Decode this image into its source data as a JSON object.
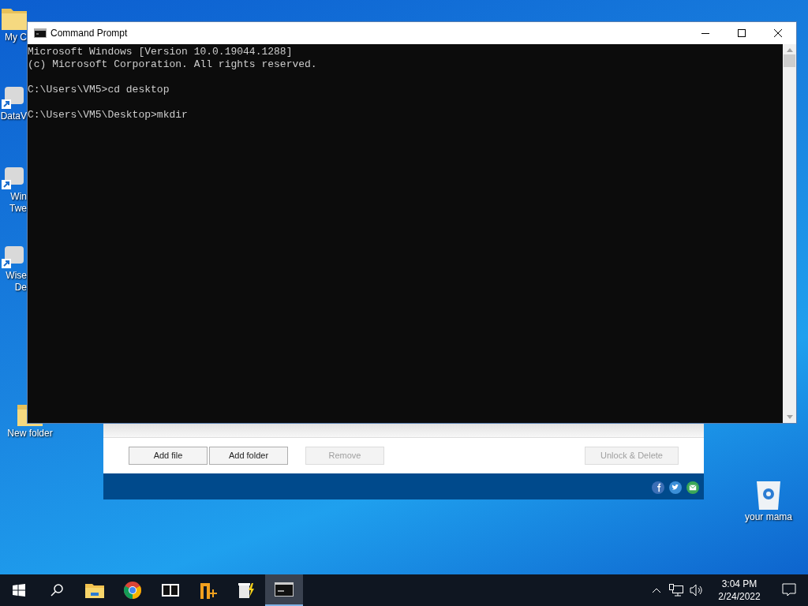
{
  "desktop_icons_cut": [
    {
      "kind": "folder",
      "label_lines": [
        "My C"
      ]
    },
    {
      "kind": "shortcut",
      "label_lines": [
        "DataV"
      ]
    },
    {
      "kind": "shortcut",
      "label_lines": [
        "Win",
        "Twe"
      ]
    },
    {
      "kind": "shortcut",
      "label_lines": [
        "Wise",
        "De"
      ]
    }
  ],
  "desktop_icons": [
    {
      "kind": "folder",
      "label_lines": [
        "New folder"
      ]
    },
    {
      "kind": "recycle",
      "label_lines": [
        "your mama"
      ]
    }
  ],
  "background_window": {
    "buttons": [
      {
        "label": "Add file",
        "disabled": false
      },
      {
        "label": "Add folder",
        "disabled": false
      },
      {
        "label": "Remove",
        "disabled": true
      },
      {
        "label": "Unlock & Delete",
        "disabled": true
      }
    ],
    "social": [
      {
        "kind": "facebook",
        "color": "#3b6fb6"
      },
      {
        "kind": "twitter",
        "color": "#3b8fd8"
      },
      {
        "kind": "mail",
        "color": "#3aa757"
      }
    ]
  },
  "window": {
    "title": "Command Prompt"
  },
  "console": {
    "blocks": [
      [
        "Microsoft Windows [Version 10.0.19044.1288]",
        "(c) Microsoft Corporation. All rights reserved."
      ],
      [
        "C:\\Users\\VM5>cd desktop"
      ],
      [
        "C:\\Users\\VM5\\Desktop>mkdir"
      ]
    ]
  },
  "taskbar": {
    "items": [
      {
        "kind": "start",
        "selected": false
      },
      {
        "kind": "search",
        "selected": false
      },
      {
        "kind": "explorer",
        "selected": false
      },
      {
        "kind": "chrome",
        "selected": false
      },
      {
        "kind": "sevenzip",
        "selected": false
      },
      {
        "kind": "notepadpp",
        "selected": false
      },
      {
        "kind": "wisedelete",
        "selected": false
      },
      {
        "kind": "terminal",
        "selected": true
      }
    ],
    "time": "3:04 PM",
    "date": "2/24/2022"
  }
}
